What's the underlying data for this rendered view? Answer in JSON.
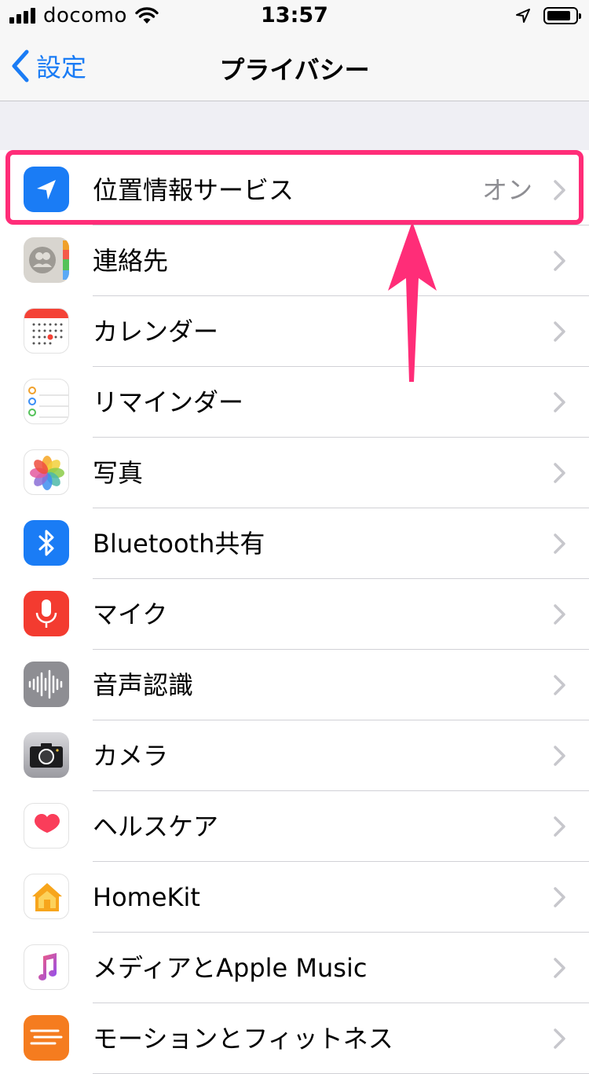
{
  "status_bar": {
    "carrier": "docomo",
    "time": "13:57"
  },
  "nav": {
    "back_label": "設定",
    "title": "プライバシー"
  },
  "rows": [
    {
      "label": "位置情報サービス",
      "value": "オン",
      "icon": "location-arrow-icon"
    },
    {
      "label": "連絡先",
      "icon": "contacts-icon"
    },
    {
      "label": "カレンダー",
      "icon": "calendar-icon"
    },
    {
      "label": "リマインダー",
      "icon": "reminders-icon"
    },
    {
      "label": "写真",
      "icon": "photos-icon"
    },
    {
      "label": "Bluetooth共有",
      "icon": "bluetooth-icon"
    },
    {
      "label": "マイク",
      "icon": "microphone-icon"
    },
    {
      "label": "音声認識",
      "icon": "speech-recognition-icon"
    },
    {
      "label": "カメラ",
      "icon": "camera-icon"
    },
    {
      "label": "ヘルスケア",
      "icon": "health-icon"
    },
    {
      "label": "HomeKit",
      "icon": "homekit-icon"
    },
    {
      "label": "メディアとApple Music",
      "icon": "music-icon"
    },
    {
      "label": "モーションとフィットネス",
      "icon": "motion-fitness-icon"
    }
  ],
  "colors": {
    "accent": "#1a7cf5",
    "highlight": "#ff2d78",
    "secondary_text": "#8e8e93",
    "grouped_background": "#efeff4"
  }
}
